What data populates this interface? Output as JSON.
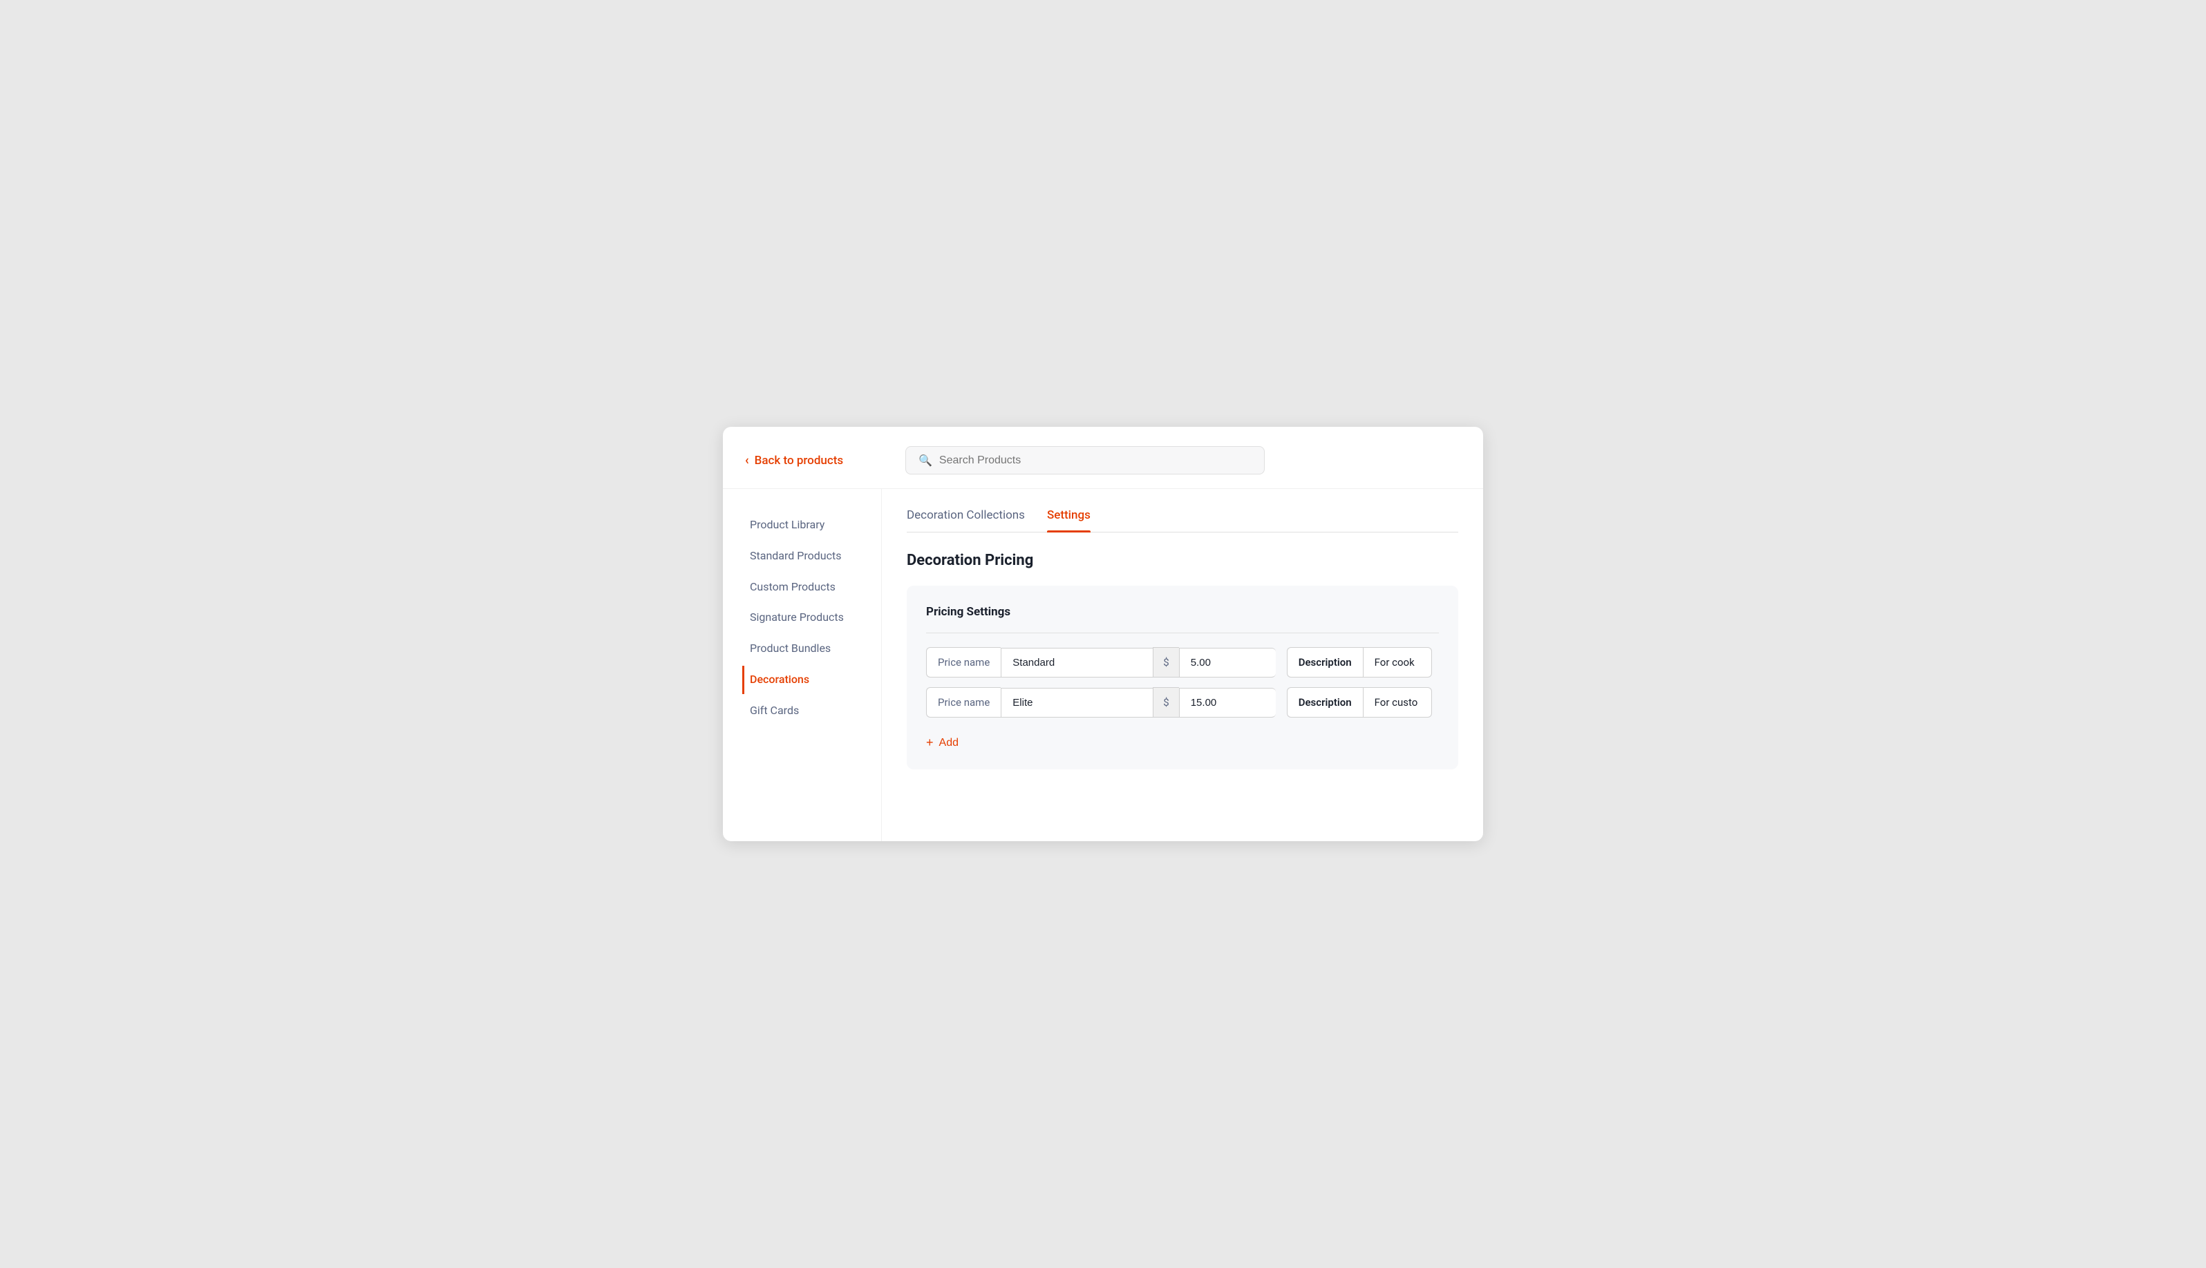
{
  "back_link": {
    "label": "Back to products"
  },
  "search": {
    "placeholder": "Search Products"
  },
  "sidebar": {
    "items": [
      {
        "id": "product-library",
        "label": "Product Library",
        "active": false
      },
      {
        "id": "standard-products",
        "label": "Standard Products",
        "active": false
      },
      {
        "id": "custom-products",
        "label": "Custom Products",
        "active": false
      },
      {
        "id": "signature-products",
        "label": "Signature Products",
        "active": false
      },
      {
        "id": "product-bundles",
        "label": "Product Bundles",
        "active": false
      },
      {
        "id": "decorations",
        "label": "Decorations",
        "active": true
      },
      {
        "id": "gift-cards",
        "label": "Gift Cards",
        "active": false
      }
    ]
  },
  "tabs": [
    {
      "id": "decoration-collections",
      "label": "Decoration Collections",
      "active": false
    },
    {
      "id": "settings",
      "label": "Settings",
      "active": true
    }
  ],
  "main": {
    "heading": "Decoration Pricing",
    "pricing_section": {
      "title": "Pricing Settings",
      "rows": [
        {
          "price_label": "Price name",
          "price_value": "Standard",
          "currency": "$",
          "amount": "5.00",
          "desc_label": "Description",
          "desc_value": "For cook"
        },
        {
          "price_label": "Price name",
          "price_value": "Elite",
          "currency": "$",
          "amount": "15.00",
          "desc_label": "Description",
          "desc_value": "For custo"
        }
      ],
      "add_label": "Add"
    }
  },
  "colors": {
    "accent": "#e53e00",
    "text_primary": "#1a202c",
    "text_secondary": "#5a6580"
  }
}
